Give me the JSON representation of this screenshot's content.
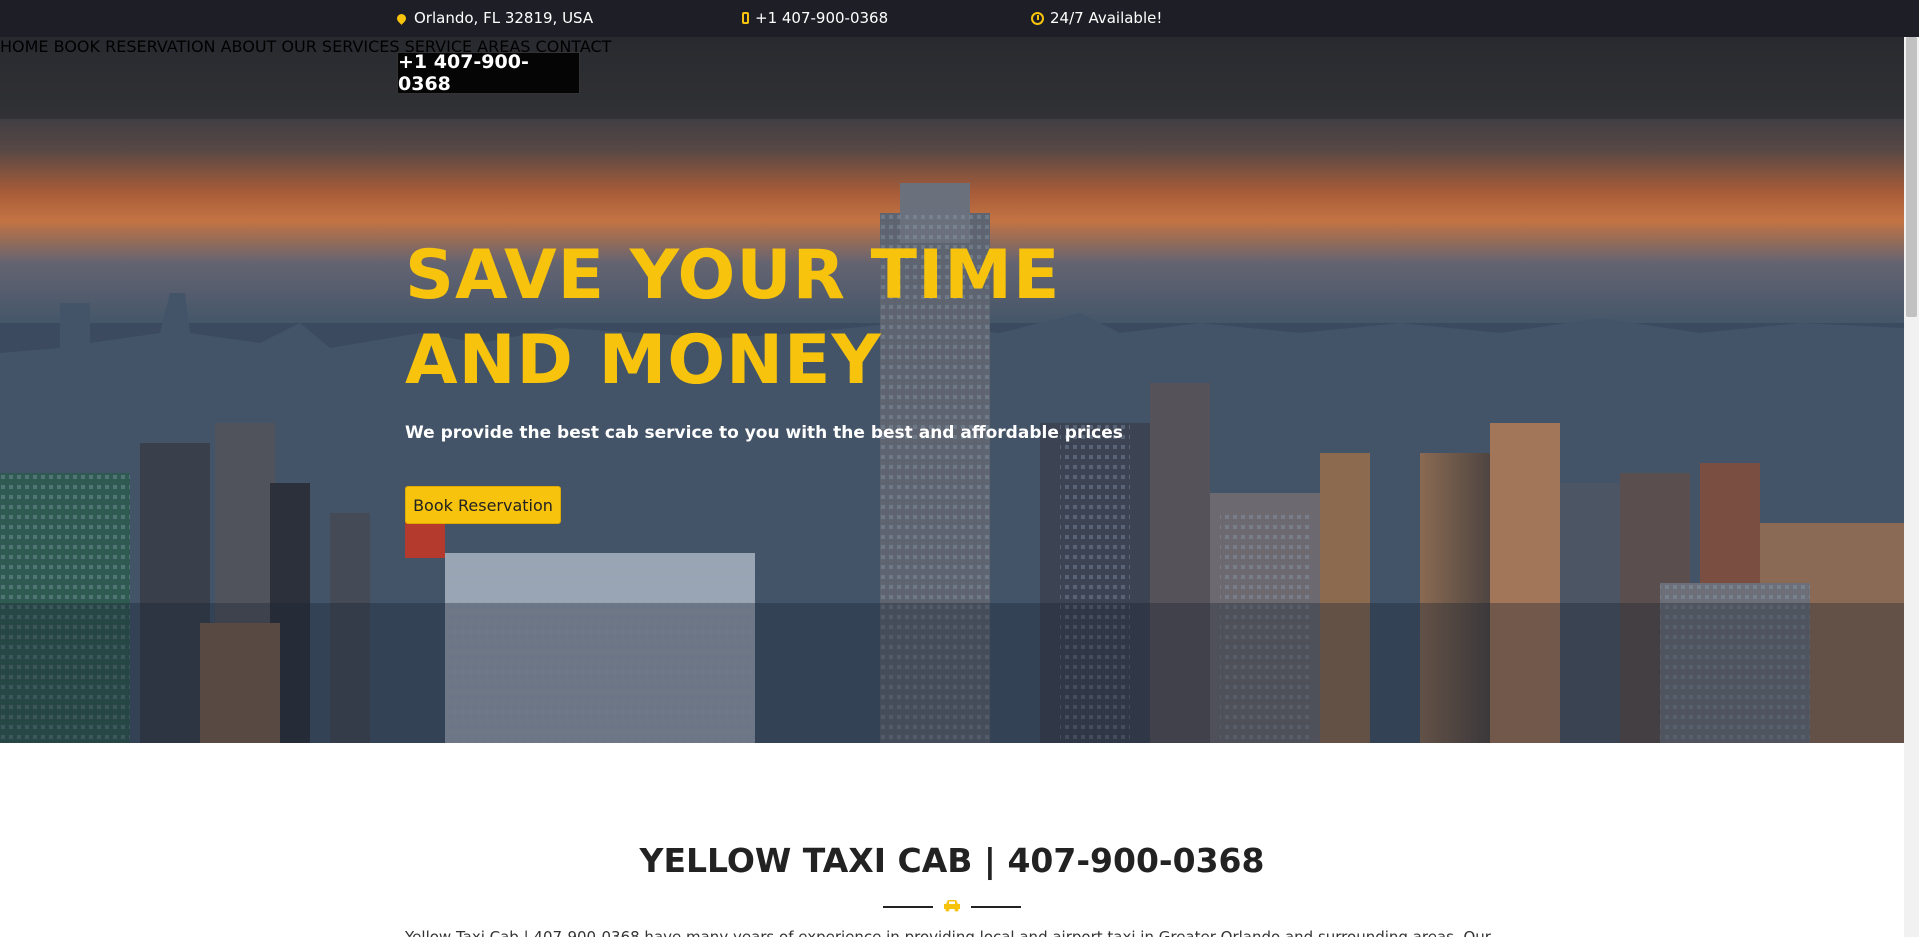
{
  "topbar": {
    "address": "Orlando, FL 32819, USA",
    "phone": "+1 407-900-0368",
    "availability": "24/7 Available!"
  },
  "header": {
    "logo_text": "+1 407-900-0368",
    "nav": [
      "HOME",
      "BOOK RESERVATION",
      "ABOUT",
      "OUR SERVICES",
      "SERVICE AREAS",
      "CONTACT"
    ]
  },
  "hero": {
    "title_line1": "SAVE YOUR TIME",
    "title_line2": "AND MONEY",
    "subtitle": "We provide the best cab service to you with the best and affordable prices",
    "button_label": "Book Reservation"
  },
  "intro": {
    "title": "YELLOW TAXI CAB | 407-900-0368",
    "text": "Yellow Taxi Cab | 407-900-0368 have many years of experience in providing local and airport taxi in Greater Orlando and surrounding areas. Our"
  },
  "colors": {
    "accent": "#f7c30c",
    "topbar_bg": "#1e1f26",
    "text_dark": "#222222"
  }
}
